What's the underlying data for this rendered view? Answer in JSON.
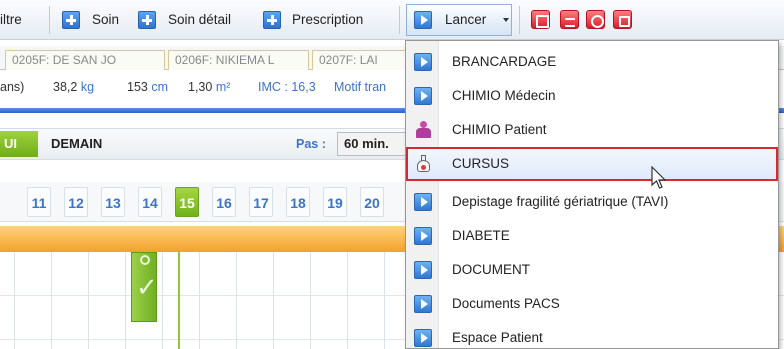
{
  "toolbar": {
    "filtre_label": "iltre",
    "soin_label": "Soin",
    "soin_detail_label": "Soin détail",
    "prescription_label": "Prescription",
    "lancer_label": "Lancer"
  },
  "patient_tabs": [
    "0205F: DE SAN JO",
    "0206F: NIKIEMA L",
    "0207F: LAI"
  ],
  "patient_info": {
    "age_suffix": "ans)",
    "weight_value": "38,2",
    "weight_unit": "kg",
    "height_value": "153",
    "height_unit": "cm",
    "bsa_value": "1,30",
    "bsa_unit": "m²",
    "imc_label": "IMC : 16,3",
    "motif_label": "Motif tran"
  },
  "day_nav": {
    "today_label": "UI",
    "tomorrow_label": "DEMAIN",
    "pas_label": "Pas :",
    "pas_value": "60 min."
  },
  "hours": [
    "11",
    "12",
    "13",
    "14",
    "15",
    "16",
    "17",
    "18",
    "19",
    "20"
  ],
  "current_hour": "15",
  "lancer_menu": [
    {
      "label": "BRANCARDAGE",
      "icon": "play-icon"
    },
    {
      "label": "CHIMIO Médecin",
      "icon": "play-icon"
    },
    {
      "label": "CHIMIO Patient",
      "icon": "patient-icon"
    },
    {
      "label": "CURSUS",
      "icon": "flask-icon",
      "highlighted": true
    },
    {
      "label": "Depistage fragilité gériatrique (TAVI)",
      "icon": "play-icon"
    },
    {
      "label": "DIABETE",
      "icon": "play-icon"
    },
    {
      "label": "DOCUMENT",
      "icon": "play-icon"
    },
    {
      "label": "Documents PACS",
      "icon": "play-icon"
    },
    {
      "label": "Espace Patient",
      "icon": "play-icon"
    }
  ],
  "colors": {
    "accent_blue": "#3c74c6",
    "current_green": "#72b11a",
    "highlight_border": "#d7282f",
    "band_orange": "#f2a12b"
  }
}
